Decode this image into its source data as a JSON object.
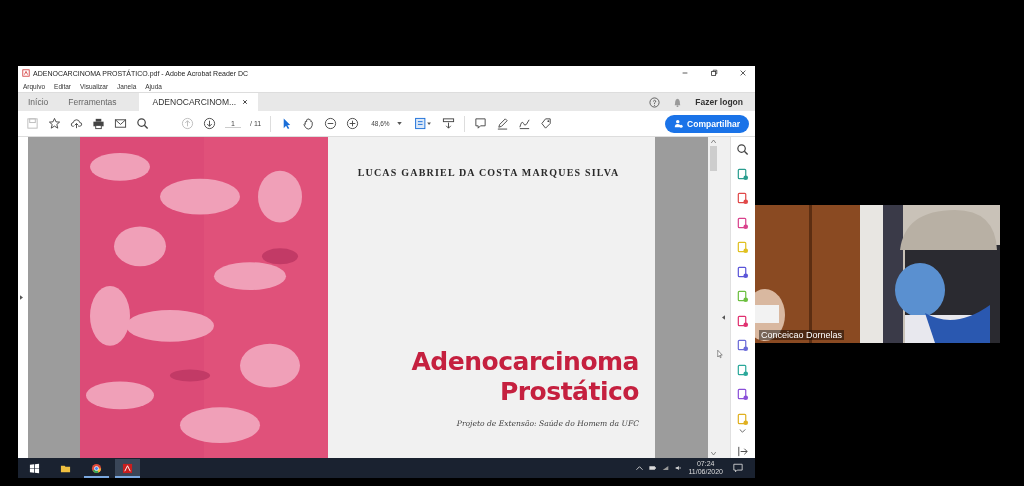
{
  "window": {
    "title": "ADENOCARCINOMA PROSTÁTICO.pdf - Adobe Acrobat Reader DC"
  },
  "menu": [
    "Arquivo",
    "Editar",
    "Visualizar",
    "Janela",
    "Ajuda"
  ],
  "tabs": [
    {
      "label": "Início",
      "selected": false
    },
    {
      "label": "Ferramentas",
      "selected": false
    },
    {
      "label": "ADENOCARCINOM...",
      "selected": true
    }
  ],
  "account": {
    "login": "Fazer logon"
  },
  "toolbar": {
    "page": "1",
    "page_count": "/ 11",
    "zoom": "48,6%",
    "share": "Compartilhar"
  },
  "document": {
    "author": "LUCAS GABRIEL DA COSTA MARQUES SILVA",
    "title_lines": [
      "Adenocarcinoma",
      "Prostático"
    ],
    "subtitle": "Projeto de Extensão: Saúde do Homem da UFC"
  },
  "taskbar": {
    "time": "07:24",
    "date": "11/06/2020"
  },
  "video": {
    "participant": "Conceicao Dornelas"
  }
}
